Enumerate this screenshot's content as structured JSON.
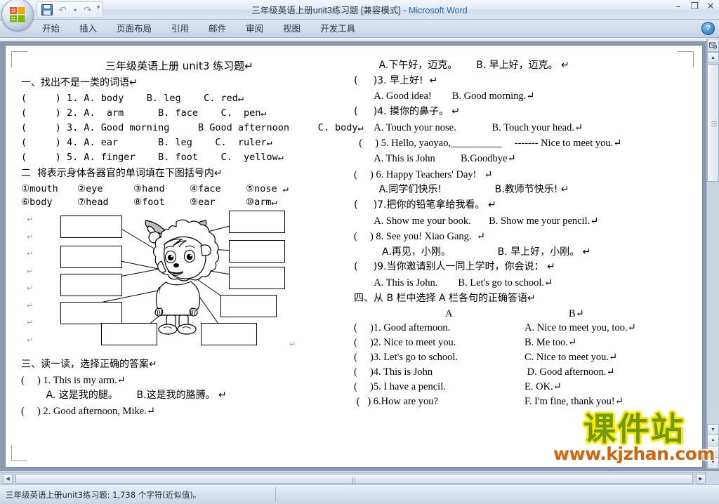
{
  "window": {
    "title_doc": "三年级英语上册unit3练习题 [兼容模式]",
    "title_sep": "-",
    "app_name": "Microsoft Word",
    "minimize": "–",
    "restore": "❐",
    "close": "✕"
  },
  "quick_access": {
    "save_icon": "save-icon",
    "undo_icon": "undo-icon",
    "undo_dropdown": "▾",
    "redo_icon": "redo-icon",
    "customize_icon": "▾"
  },
  "ribbon": {
    "tabs": [
      {
        "label": "开始",
        "active": false
      },
      {
        "label": "插入",
        "active": false
      },
      {
        "label": "页面布局",
        "active": false
      },
      {
        "label": "引用",
        "active": false
      },
      {
        "label": "邮件",
        "active": false
      },
      {
        "label": "审阅",
        "active": false
      },
      {
        "label": "视图",
        "active": false
      },
      {
        "label": "开发工具",
        "active": false
      }
    ],
    "help_label": "?"
  },
  "document": {
    "title": "三年级英语上册 unit3 练习题↵",
    "section1": {
      "heading": "一、找出不是一类的词语↵",
      "items": [
        "(     ) 1. A. body    B. leg    C. red↵",
        "(     ) 2. A.  arm      B. face    C.  pen↵",
        "(     ) 3. A. Good morning     B Good afternoon     C. body↵",
        "(     ) 4. A. ear       B. leg    C.  ruler↵",
        "(     ) 5. A. finger    B. foot    C.  yellow↵"
      ]
    },
    "section2": {
      "heading": "二  将表示身体各器官的单词填在下图括号内↵",
      "words_row1": [
        "①mouth",
        "②eye",
        "③hand",
        "④face",
        "⑤nose  ↵"
      ],
      "words_row2": [
        "⑥body",
        "⑦head",
        "⑧foot",
        "⑨ear",
        "⑩arm↵"
      ],
      "figure_alt": "卡通羊图，带有空白标注框和引线"
    },
    "section3": {
      "heading": "三、读一读，选择正确的答案↵",
      "lines": [
        "(     ) 1. This is my arm.↵",
        "        A. 这是我的腿。      B.这是我的胳膊。 ↵",
        "(     ) 2. Good afternoon, Mike.↵"
      ]
    },
    "right_column": [
      "        A.下午好，迈克。      B. 早上好，迈克。 ↵",
      "(     )3. 早上好!  ↵",
      "        A. Good idea!        B. Good morning.↵",
      "(     )4. 摸你的鼻子。 ↵",
      "        A. Touch your nose.              B. Touch your head.↵",
      "  (     ) 5. Hello, yaoyao,__________     ------- Nice to meet you.↵",
      "        A. This is John          B.Goodbye↵",
      "(     ) 6. Happy Teachers' Day!   ↵",
      "        A.同学们快乐!                 B.教师节快乐! ↵",
      "(     )7.把你的铅笔拿给我看。 ↵",
      "        A. Show me your book.       B. Show me your pencil.↵",
      "(     ) 8. See you! Xiao Gang.  ↵",
      "         A.再见，小刚。               B. 早上好，小刚。 ↵",
      "(     )9.当你邀请别人一同上学时，你会说： ↵",
      "        A. This is John.        B. Let's go to school.↵"
    ],
    "section4": {
      "heading": "四、从 B 栏中选择 A 栏各句的正确答语↵",
      "col_a_header": "A",
      "col_b_header": "B↵",
      "rows": [
        {
          "a": "(     )1. Good afternoon.",
          "b": "A. Nice to meet you, too.↵"
        },
        {
          "a": "(     )2. Nice to meet you.",
          "b": "B. Me too.↵"
        },
        {
          "a": "(     )3. Let's go to school.",
          "b": "C. Nice to meet you.↵"
        },
        {
          "a": "(     )4. This is John",
          "b": " D. Good afternoon.↵"
        },
        {
          "a": "(     )5. I have a pencil.",
          "b": "E. OK.↵"
        },
        {
          "a": " (   ) 6.How are you?",
          "b": "F. I'm fine, thank you!↵"
        }
      ]
    }
  },
  "watermark": {
    "brand_cn": "课件站",
    "url": "www.kjzhan.com",
    "brand_color": "#6f9b12",
    "brand_outline": "#ffe800",
    "url_color": "#d4640a"
  },
  "statusbar": {
    "text": "三年级英语上册unit3练习题: 1,738 个字符(近似值)。"
  },
  "scrollbars": {
    "v_up": "▲",
    "v_down": "▼",
    "v_prev_page": "⯅",
    "v_select_object": "◎",
    "v_next_page": "⯆",
    "h_left": "◀",
    "h_right": "▶",
    "select_browse_object": "browse-object-icon"
  }
}
